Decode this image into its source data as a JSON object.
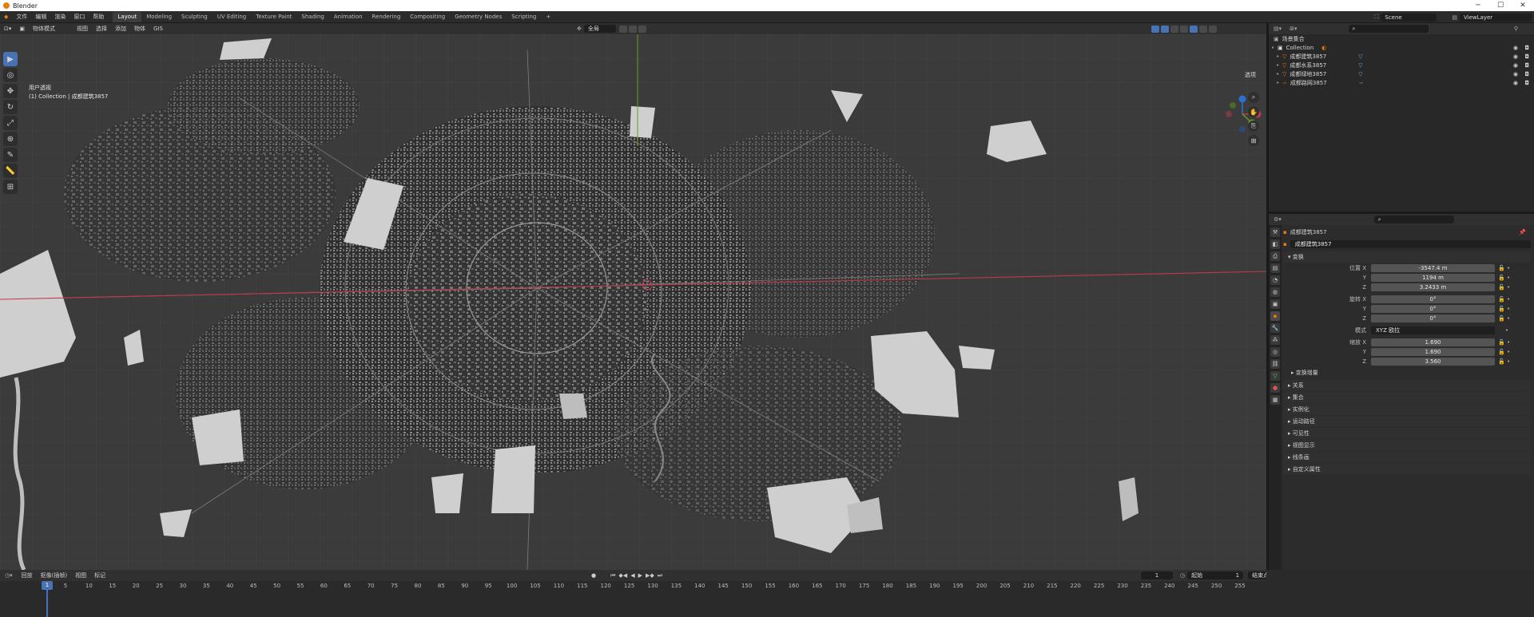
{
  "titlebar": {
    "title": "Blender",
    "minimize": "─",
    "maximize": "☐",
    "close": "✕"
  },
  "menu": [
    "文件",
    "编辑",
    "渲染",
    "窗口",
    "帮助"
  ],
  "workspaces": [
    "Layout",
    "Modeling",
    "Sculpting",
    "UV Editing",
    "Texture Paint",
    "Shading",
    "Animation",
    "Rendering",
    "Compositing",
    "Geometry Nodes",
    "Scripting",
    "+"
  ],
  "scene": {
    "scene_name": "Scene",
    "view_layer": "ViewLayer"
  },
  "viewport_header": {
    "mode": "物体模式",
    "menus": [
      "视图",
      "选择",
      "添加",
      "物体",
      "GIS"
    ],
    "orientation": "全局",
    "options": "选项"
  },
  "viewport_info": {
    "view_name": "用户透视",
    "collection_line": "(1) Collection | 成都建筑3857"
  },
  "tools": [
    "▶",
    "◎",
    "✥",
    "↻",
    "⤢",
    "⊕",
    "✎",
    "📏",
    "⊞"
  ],
  "outliner": {
    "header": "场景集合",
    "rows": [
      {
        "label": "Collection",
        "kind": "collection"
      },
      {
        "label": "成都建筑3857",
        "kind": "mesh"
      },
      {
        "label": "成都水系3857",
        "kind": "mesh"
      },
      {
        "label": "成都绿地3857",
        "kind": "mesh"
      },
      {
        "label": "成都路网3857",
        "kind": "curve"
      }
    ]
  },
  "properties": {
    "object_name_crumb": "成都建筑3857",
    "object_name_field": "成都建筑3857",
    "transform_section": "变换",
    "location": {
      "label": "位置 X",
      "x": "-3547.4 m",
      "y": "1194 m",
      "z": "3.2433 m"
    },
    "rotation": {
      "label": "旋转 X",
      "x": "0°",
      "y": "0°",
      "z": "0°"
    },
    "rotation_mode": {
      "label": "模式",
      "value": "XYZ 欧拉"
    },
    "scale": {
      "label": "缩放 X",
      "x": "1.690",
      "y": "1.690",
      "z": "3.560"
    },
    "y_label": "Y",
    "z_label": "Z",
    "delta_section": "变换增量",
    "sections": [
      "关系",
      "集合",
      "实例化",
      "运动路径",
      "可见性",
      "视图显示",
      "线条画",
      "自定义属性"
    ]
  },
  "timeline": {
    "menus": [
      "回放",
      "抠像(插帧)",
      "视图",
      "标记"
    ],
    "current_frame": "1",
    "start_label": "起始",
    "start": "1",
    "end_label": "结束点",
    "end": "250",
    "frames": [
      "5",
      "10",
      "15",
      "20",
      "25",
      "30",
      "35",
      "40",
      "45",
      "50",
      "55",
      "60",
      "65",
      "70",
      "75",
      "80",
      "85",
      "90",
      "95",
      "100",
      "105",
      "110",
      "115",
      "120",
      "125",
      "130",
      "135",
      "140",
      "145",
      "150",
      "155",
      "160",
      "165",
      "170",
      "175",
      "180",
      "185",
      "190",
      "195",
      "200",
      "205",
      "210",
      "215",
      "220",
      "225",
      "230",
      "235",
      "240",
      "245",
      "250",
      "255"
    ]
  },
  "colors": {
    "accent": "#4772b3",
    "x_axis": "#c0394b",
    "y_axis": "#6a9a1f",
    "z_axis": "#2f6ed3"
  }
}
